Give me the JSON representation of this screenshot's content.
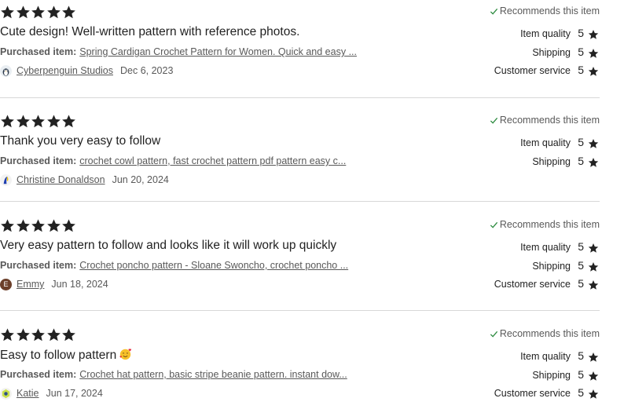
{
  "colors": {
    "star": "#222222",
    "check": "#2b8a3e",
    "divider": "#d8d8d8",
    "muted": "#595959"
  },
  "icons": {
    "star": "star-icon",
    "check": "checkmark-icon"
  },
  "reviews": [
    {
      "stars": 5,
      "text": "Cute design! Well-written pattern with reference photos.",
      "purchased_label": "Purchased item:",
      "purchased_item": "Spring Cardigan Crochet Pattern for Women. Quick and easy ...",
      "author": "Cyberpenguin Studios",
      "date": "Dec 6, 2023",
      "recommends": "Recommends this item",
      "ratings": [
        {
          "label": "Item quality",
          "value": "5"
        },
        {
          "label": "Shipping",
          "value": "5"
        },
        {
          "label": "Customer service",
          "value": "5"
        }
      ]
    },
    {
      "stars": 5,
      "text": "Thank you very easy to follow",
      "purchased_label": "Purchased item:",
      "purchased_item": "crochet cowl pattern, fast crochet pattern pdf pattern easy c...",
      "author": "Christine Donaldson",
      "date": "Jun 20, 2024",
      "recommends": "Recommends this item",
      "ratings": [
        {
          "label": "Item quality",
          "value": "5"
        },
        {
          "label": "Shipping",
          "value": "5"
        }
      ]
    },
    {
      "stars": 5,
      "text": "Very easy pattern to follow and looks like it will work up quickly",
      "purchased_label": "Purchased item:",
      "purchased_item": "Crochet poncho pattern - Sloane Swoncho, crochet poncho ...",
      "author": "Emmy",
      "avatar_letter": "E",
      "date": "Jun 18, 2024",
      "recommends": "Recommends this item",
      "ratings": [
        {
          "label": "Item quality",
          "value": "5"
        },
        {
          "label": "Shipping",
          "value": "5"
        },
        {
          "label": "Customer service",
          "value": "5"
        }
      ]
    },
    {
      "stars": 5,
      "text": "Easy to follow pattern",
      "purchased_label": "Purchased item:",
      "purchased_item": "Crochet hat pattern, basic stripe beanie pattern. instant dow...",
      "author": "Katie",
      "date": "Jun 17, 2024",
      "recommends": "Recommends this item",
      "ratings": [
        {
          "label": "Item quality",
          "value": "5"
        },
        {
          "label": "Shipping",
          "value": "5"
        },
        {
          "label": "Customer service",
          "value": "5"
        }
      ]
    }
  ]
}
